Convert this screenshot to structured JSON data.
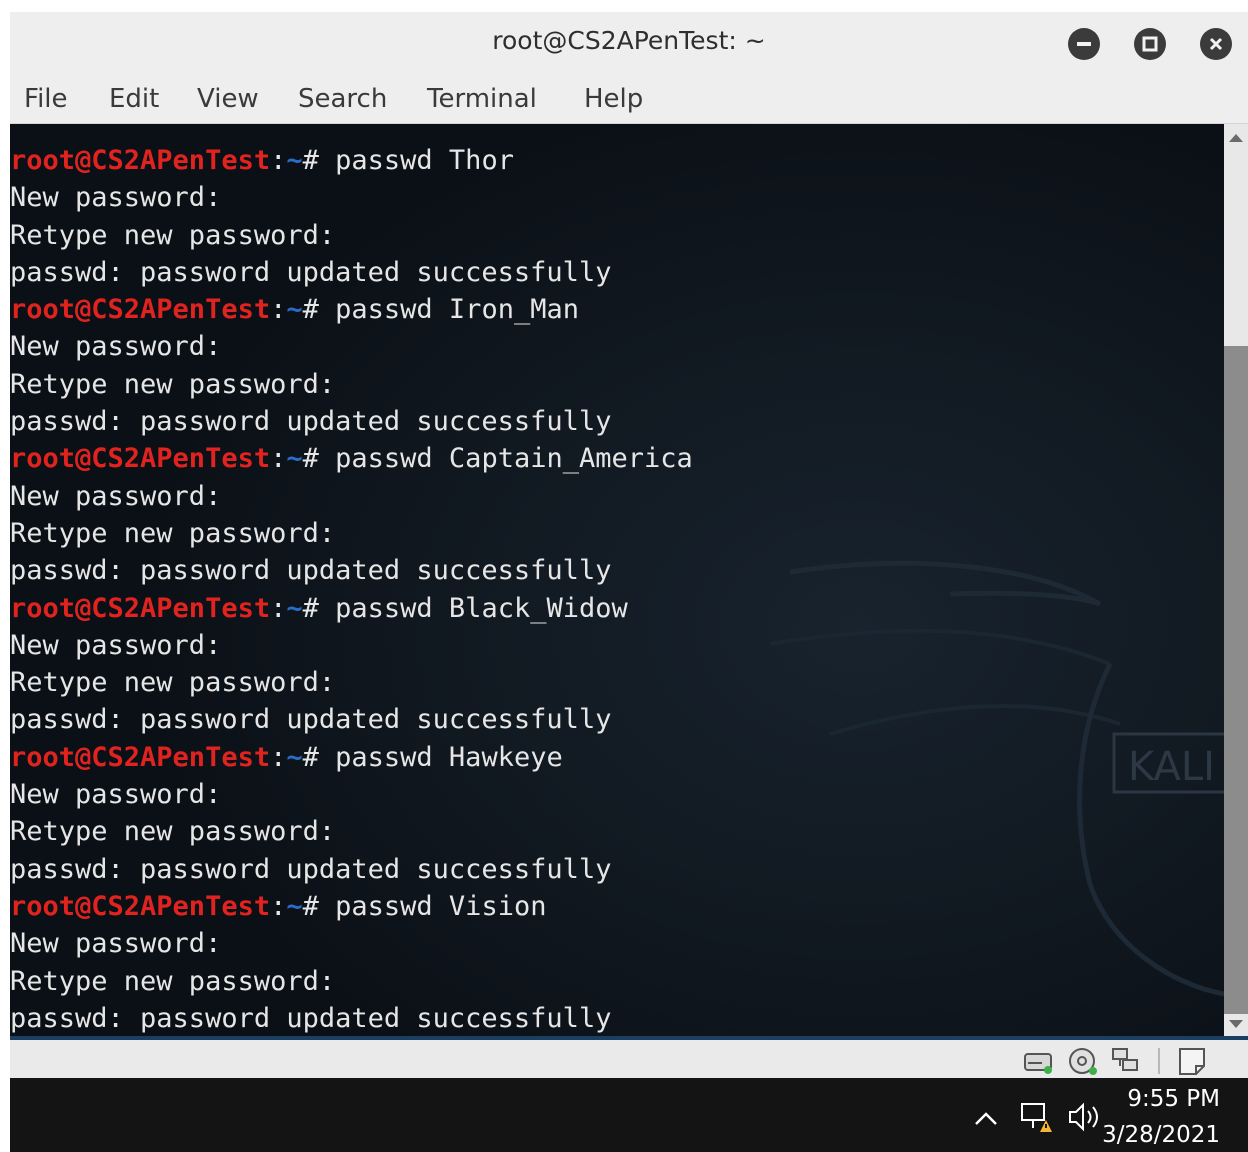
{
  "window": {
    "title": "root@CS2APenTest: ~"
  },
  "menu": {
    "items": [
      "File",
      "Edit",
      "View",
      "Search",
      "Terminal",
      "Help"
    ]
  },
  "terminal": {
    "prompt_user": "root@CS2APenTest",
    "prompt_colon": ":",
    "prompt_path": "~",
    "prompt_symbol": "# ",
    "commands": [
      "passwd Thor",
      "passwd Iron_Man",
      "passwd Captain_America",
      "passwd Black_Widow",
      "passwd Hawkeye",
      "passwd Vision"
    ],
    "output": {
      "new_password": "New password:",
      "retype": "Retype new password:",
      "success": "passwd: password updated successfully"
    },
    "watermark": "KALI"
  },
  "vm_status": {
    "icons": [
      "hard-disk-icon",
      "optical-disk-icon",
      "network-icon",
      "shared-folder-icon"
    ]
  },
  "taskbar": {
    "tray_icons": [
      "chevron-up-icon",
      "network-warning-icon",
      "speaker-icon"
    ],
    "time": "9:55 PM",
    "date": "3/28/2021"
  },
  "colors": {
    "prompt_user": "#e0231f",
    "prompt_path": "#2a6cc8",
    "terminal_bg": "#0b1016",
    "terminal_fg": "#e6e6e6"
  }
}
